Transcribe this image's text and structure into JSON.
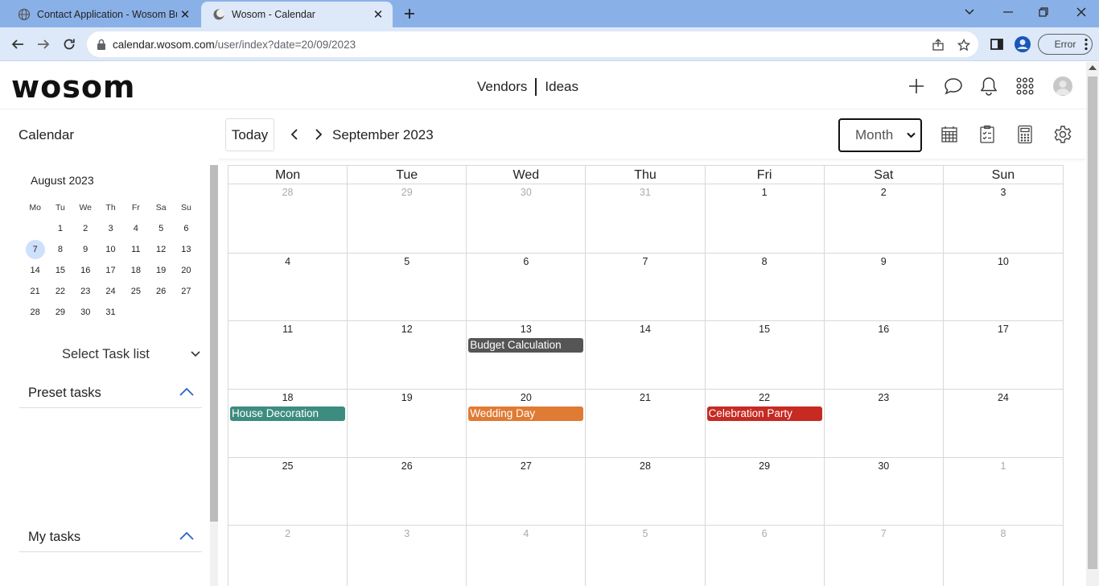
{
  "browser": {
    "tabs": [
      {
        "title": "Contact Application - Wosom Bu",
        "active": false
      },
      {
        "title": "Wosom - Calendar",
        "active": true
      }
    ],
    "url_host": "calendar.wosom.com",
    "url_path": "/user/index?date=20/09/2023",
    "profile_status": "Error"
  },
  "header": {
    "logo": "wosom",
    "nav": [
      "Vendors",
      "Ideas"
    ]
  },
  "calendar_bar": {
    "section_label": "Calendar",
    "today_label": "Today",
    "month_title": "September 2023",
    "view_value": "Month"
  },
  "sidebar": {
    "mini_title": "August 2023",
    "weekday_heads": [
      "Mo",
      "Tu",
      "We",
      "Th",
      "Fr",
      "Sa",
      "Su"
    ],
    "mini_weeks": [
      [
        "",
        "1",
        "2",
        "3",
        "4",
        "5",
        "6"
      ],
      [
        "7",
        "8",
        "9",
        "10",
        "11",
        "12",
        "13"
      ],
      [
        "14",
        "15",
        "16",
        "17",
        "18",
        "19",
        "20"
      ],
      [
        "21",
        "22",
        "23",
        "24",
        "25",
        "26",
        "27"
      ],
      [
        "28",
        "29",
        "30",
        "31",
        "",
        "",
        ""
      ]
    ],
    "mini_selected": "7",
    "task_list_placeholder": "Select Task list",
    "preset_tasks_label": "Preset tasks",
    "my_tasks_label": "My tasks"
  },
  "month_grid": {
    "weekdays": [
      "Mon",
      "Tue",
      "Wed",
      "Thu",
      "Fri",
      "Sat",
      "Sun"
    ],
    "weeks": [
      [
        {
          "d": "28",
          "o": true
        },
        {
          "d": "29",
          "o": true
        },
        {
          "d": "30",
          "o": true
        },
        {
          "d": "31",
          "o": true
        },
        {
          "d": "1"
        },
        {
          "d": "2"
        },
        {
          "d": "3"
        }
      ],
      [
        {
          "d": "4"
        },
        {
          "d": "5"
        },
        {
          "d": "6"
        },
        {
          "d": "7"
        },
        {
          "d": "8"
        },
        {
          "d": "9"
        },
        {
          "d": "10"
        }
      ],
      [
        {
          "d": "11"
        },
        {
          "d": "12"
        },
        {
          "d": "13",
          "event": {
            "title": "Budget Calculation",
            "color": "#555555"
          }
        },
        {
          "d": "14"
        },
        {
          "d": "15"
        },
        {
          "d": "16"
        },
        {
          "d": "17"
        }
      ],
      [
        {
          "d": "18",
          "event": {
            "title": "House Decoration",
            "color": "#3d8c80"
          }
        },
        {
          "d": "19"
        },
        {
          "d": "20",
          "event": {
            "title": "Wedding Day",
            "color": "#e07b34"
          }
        },
        {
          "d": "21"
        },
        {
          "d": "22",
          "event": {
            "title": "Celebration Party",
            "color": "#c62a22"
          }
        },
        {
          "d": "23"
        },
        {
          "d": "24"
        }
      ],
      [
        {
          "d": "25"
        },
        {
          "d": "26"
        },
        {
          "d": "27"
        },
        {
          "d": "28"
        },
        {
          "d": "29"
        },
        {
          "d": "30"
        },
        {
          "d": "1",
          "o": true
        }
      ],
      [
        {
          "d": "2",
          "o": true
        },
        {
          "d": "3",
          "o": true
        },
        {
          "d": "4",
          "o": true
        },
        {
          "d": "5",
          "o": true
        },
        {
          "d": "6",
          "o": true
        },
        {
          "d": "7",
          "o": true
        },
        {
          "d": "8",
          "o": true
        }
      ]
    ]
  }
}
